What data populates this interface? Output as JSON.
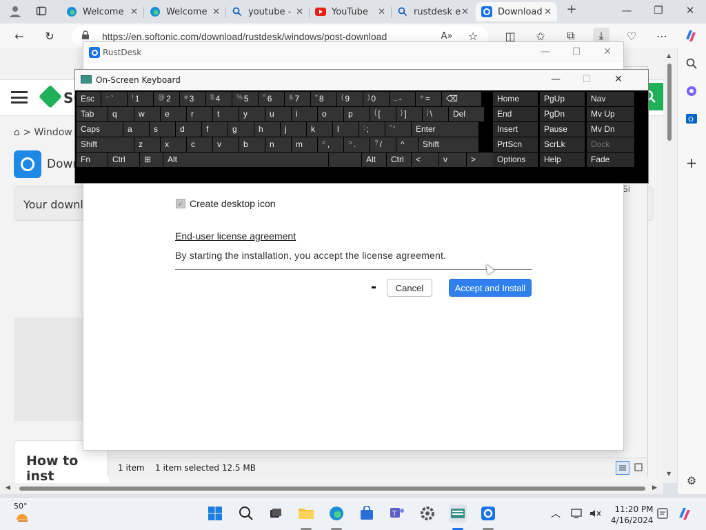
{
  "browser": {
    "tabs": [
      {
        "label": "Welcome",
        "icon": "edge-icon"
      },
      {
        "label": "Welcome",
        "icon": "edge-icon"
      },
      {
        "label": "youtube -",
        "icon": "search-icon"
      },
      {
        "label": "YouTube",
        "icon": "youtube-icon"
      },
      {
        "label": "rustdesk e",
        "icon": "search-icon"
      },
      {
        "label": "Download",
        "icon": "softonic-icon"
      }
    ],
    "url": "https://en.softonic.com/download/rustdesk/windows/post-download"
  },
  "page": {
    "logo_text": "SO",
    "breadcrumb": "> Window",
    "app_title": "Down",
    "download_text": "Your downl",
    "howto_title": "How to inst"
  },
  "explorer": {
    "right_fragment": "Si",
    "status_items": "1 item",
    "status_selected": "1 item selected  12.5 MB"
  },
  "rustdesk": {
    "title": "RustDesk",
    "create_icon_label": "Create desktop icon",
    "create_icon_checked": true,
    "eula_link": "End-user license agreement",
    "accept_text": "By starting the installation, you accept the license agreement.",
    "cancel_label": "Cancel",
    "install_label": "Accept and Install"
  },
  "osk": {
    "title": "On-Screen Keyboard",
    "row1": [
      {
        "l": "Esc"
      },
      {
        "s": "~",
        "l": "`"
      },
      {
        "s": "!",
        "l": "1"
      },
      {
        "s": "@",
        "l": "2"
      },
      {
        "s": "#",
        "l": "3"
      },
      {
        "s": "$",
        "l": "4"
      },
      {
        "s": "%",
        "l": "5"
      },
      {
        "s": "^",
        "l": "6"
      },
      {
        "s": "&",
        "l": "7"
      },
      {
        "s": "*",
        "l": "8"
      },
      {
        "s": "(",
        "l": "9"
      },
      {
        "s": ")",
        "l": "0"
      },
      {
        "s": "_",
        "l": "-"
      },
      {
        "s": "+",
        "l": "="
      },
      {
        "l": "⌫"
      }
    ],
    "row2": [
      {
        "l": "Tab"
      },
      {
        "l": "q"
      },
      {
        "l": "w"
      },
      {
        "l": "e"
      },
      {
        "l": "r"
      },
      {
        "l": "t"
      },
      {
        "l": "y"
      },
      {
        "l": "u"
      },
      {
        "l": "i"
      },
      {
        "l": "o"
      },
      {
        "l": "p"
      },
      {
        "s": "{",
        "l": "["
      },
      {
        "s": "}",
        "l": "]"
      },
      {
        "s": "|",
        "l": "\\"
      },
      {
        "l": "Del"
      }
    ],
    "row3": [
      {
        "l": "Caps"
      },
      {
        "l": "a"
      },
      {
        "l": "s"
      },
      {
        "l": "d"
      },
      {
        "l": "f"
      },
      {
        "l": "g"
      },
      {
        "l": "h"
      },
      {
        "l": "j"
      },
      {
        "l": "k"
      },
      {
        "l": "l"
      },
      {
        "s": ":",
        "l": ";"
      },
      {
        "s": "\"",
        "l": "'"
      },
      {
        "l": "Enter"
      }
    ],
    "row4": [
      {
        "l": "Shift"
      },
      {
        "l": "z"
      },
      {
        "l": "x"
      },
      {
        "l": "c"
      },
      {
        "l": "v"
      },
      {
        "l": "b"
      },
      {
        "l": "n"
      },
      {
        "l": "m"
      },
      {
        "s": "<",
        "l": ","
      },
      {
        "s": ">",
        "l": "."
      },
      {
        "s": "?",
        "l": "/"
      },
      {
        "l": "^"
      },
      {
        "l": "Shift"
      }
    ],
    "row5": [
      {
        "l": "Fn"
      },
      {
        "l": "Ctrl"
      },
      {
        "l": "⊞"
      },
      {
        "l": "Alt"
      },
      {
        "l": ""
      },
      {
        "l": "Alt"
      },
      {
        "l": "Ctrl"
      },
      {
        "l": "<"
      },
      {
        "l": "v"
      },
      {
        "l": ">"
      },
      {
        "l": "▤"
      }
    ],
    "nav": [
      [
        "Home",
        "PgUp",
        "Nav"
      ],
      [
        "End",
        "PgDn",
        "Mv Up"
      ],
      [
        "Insert",
        "Pause",
        "Mv Dn"
      ],
      [
        "PrtScn",
        "ScrLk",
        "Dock"
      ],
      [
        "Options",
        "Help",
        "Fade"
      ]
    ]
  },
  "taskbar": {
    "weather": "50°",
    "time": "11:20 PM",
    "date": "4/16/2024"
  }
}
